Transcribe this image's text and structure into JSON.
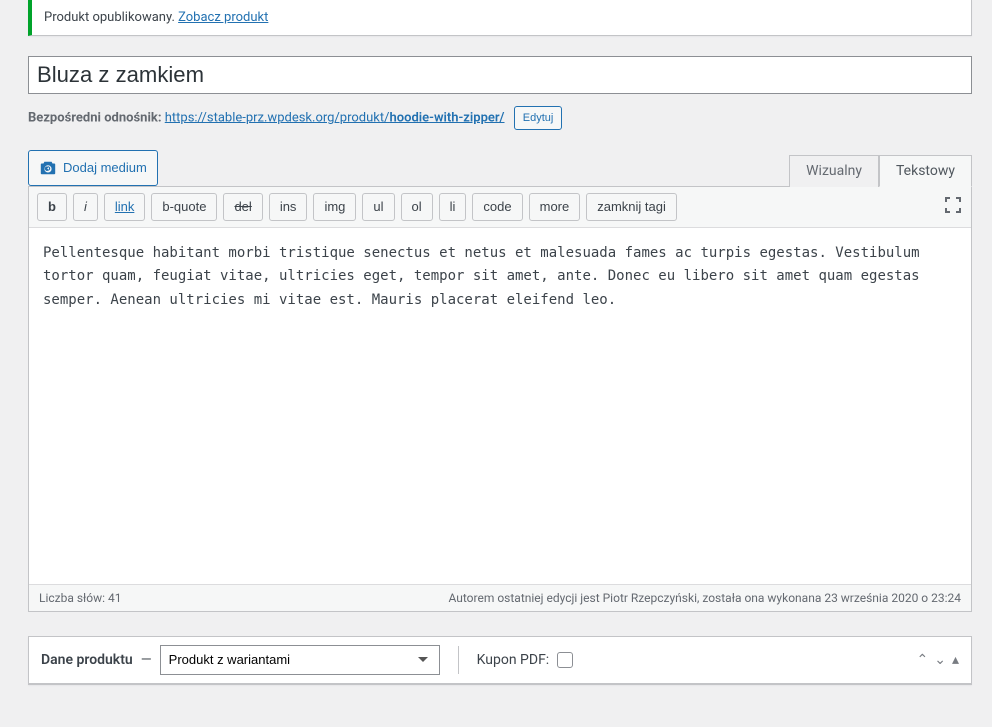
{
  "notice": {
    "text": "Produkt opublikowany. ",
    "link": "Zobacz produkt"
  },
  "title": "Bluza z zamkiem",
  "permalink": {
    "label": "Bezpośredni odnośnik: ",
    "base": "https://stable-prz.wpdesk.org/produkt/",
    "slug": "hoodie-with-zipper/",
    "edit": "Edytuj"
  },
  "media_button": "Dodaj medium",
  "tabs": {
    "visual": "Wizualny",
    "text": "Tekstowy"
  },
  "quicktags": {
    "b": "b",
    "i": "i",
    "link": "link",
    "bquote": "b-quote",
    "del": "del",
    "ins": "ins",
    "img": "img",
    "ul": "ul",
    "ol": "ol",
    "li": "li",
    "code": "code",
    "more": "more",
    "close": "zamknij tagi"
  },
  "content": "Pellentesque habitant morbi tristique senectus et netus et malesuada fames ac turpis egestas. Vestibulum tortor quam, feugiat vitae, ultricies eget, tempor sit amet, ante. Donec eu libero sit amet quam egestas semper. Aenean ultricies mi vitae est. Mauris placerat eleifend leo.",
  "status": {
    "word_count_label": "Liczba słów: ",
    "word_count": "41",
    "last_edit": "Autorem ostatniej edycji jest Piotr Rzepczyński, została ona wykonana 23 września 2020 o 23:24"
  },
  "product_data": {
    "heading": "Dane produktu",
    "dash": " — ",
    "type_selected": "Produkt z wariantami",
    "kupon_label": "Kupon PDF:"
  }
}
